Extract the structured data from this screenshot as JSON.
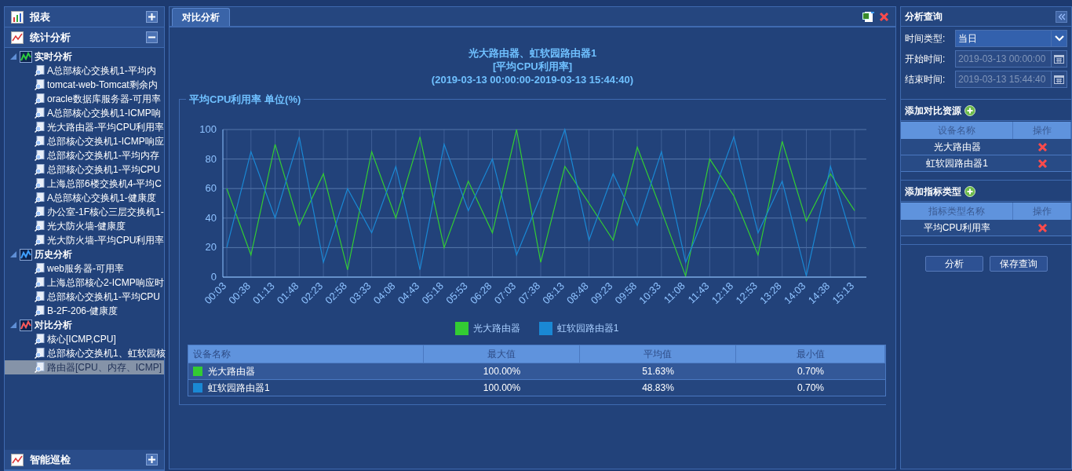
{
  "sidebar": {
    "sections": [
      {
        "title": "报表",
        "expanded": false
      },
      {
        "title": "统计分析",
        "expanded": true,
        "tree": [
          {
            "label": "实时分析",
            "expanded": true,
            "children": [
              {
                "label": "A总部核心交换机1-平均内",
                "selected": false
              },
              {
                "label": "tomcat-web-Tomcat剩余内",
                "selected": false
              },
              {
                "label": "oracle数据库服务器-可用率",
                "selected": false
              },
              {
                "label": "A总部核心交换机1-ICMP响",
                "selected": false
              },
              {
                "label": "光大路由器-平均CPU利用率",
                "selected": false
              },
              {
                "label": "总部核心交换机1-ICMP响应",
                "selected": false
              },
              {
                "label": "总部核心交换机1-平均内存",
                "selected": false
              },
              {
                "label": "总部核心交换机1-平均CPU",
                "selected": false
              },
              {
                "label": "上海总部6楼交换机4-平均C",
                "selected": false
              },
              {
                "label": "A总部核心交换机1-健康度",
                "selected": false
              },
              {
                "label": "办公室-1F核心三层交换机1-",
                "selected": false
              },
              {
                "label": "光大防火墙-健康度",
                "selected": false
              },
              {
                "label": "光大防火墙-平均CPU利用率",
                "selected": false
              }
            ]
          },
          {
            "label": "历史分析",
            "expanded": true,
            "children": [
              {
                "label": "web服务器-可用率",
                "selected": false
              },
              {
                "label": "上海总部核心2-ICMP响应时",
                "selected": false
              },
              {
                "label": "总部核心交换机1-平均CPU",
                "selected": false
              },
              {
                "label": "B-2F-206-健康度",
                "selected": false
              }
            ]
          },
          {
            "label": "对比分析",
            "expanded": true,
            "children": [
              {
                "label": "核心[ICMP,CPU]",
                "selected": false
              },
              {
                "label": "总部核心交换机1、虹软园核",
                "selected": false
              },
              {
                "label": "路由器[CPU、内存、ICMP]",
                "selected": true
              }
            ]
          }
        ]
      },
      {
        "title": "智能巡检",
        "expanded": false
      }
    ]
  },
  "main": {
    "tabs": [
      {
        "label": "对比分析",
        "selected": true
      }
    ],
    "report_title": [
      "光大路由器、虹软园路由器1",
      "[平均CPU利用率]",
      "(2019-03-13 00:00:00-2019-03-13 15:44:40)"
    ],
    "chart_data": {
      "type": "line",
      "grid": true,
      "legend": "bottom",
      "title": "平均CPU利用率 单位(%)",
      "ylim": [
        0,
        100
      ],
      "yticks": [
        0,
        20,
        40,
        60,
        80,
        100
      ],
      "categories": [
        "00:03",
        "00:38",
        "01:13",
        "01:48",
        "02:23",
        "02:58",
        "03:33",
        "04:08",
        "04:43",
        "05:18",
        "05:53",
        "06:28",
        "07:03",
        "07:38",
        "08:13",
        "08:48",
        "09:23",
        "09:58",
        "10:33",
        "11:08",
        "11:43",
        "12:18",
        "12:53",
        "13:28",
        "14:03",
        "14:38",
        "15:13"
      ],
      "series": [
        {
          "name": "光大路由器",
          "color": "#33cc33",
          "values": [
            60,
            15,
            90,
            35,
            70,
            5,
            85,
            40,
            95,
            20,
            65,
            30,
            100,
            10,
            75,
            50,
            25,
            88,
            45,
            0.7,
            80,
            55,
            15,
            92,
            38,
            70,
            45
          ]
        },
        {
          "name": "虹软园路由器1",
          "color": "#1a88d4",
          "values": [
            20,
            85,
            40,
            95,
            10,
            60,
            30,
            75,
            5,
            90,
            45,
            80,
            15,
            55,
            100,
            25,
            70,
            35,
            85,
            10,
            50,
            95,
            30,
            65,
            0.7,
            75,
            20
          ]
        }
      ]
    },
    "stats_table": {
      "columns": [
        "设备名称",
        "最大值",
        "平均值",
        "最小值"
      ],
      "rows": [
        {
          "name": "光大路由器",
          "color": "#33cc33",
          "max": "100.00%",
          "avg": "51.63%",
          "min": "0.70%"
        },
        {
          "name": "虹软园路由器1",
          "color": "#1a88d4",
          "max": "100.00%",
          "avg": "48.83%",
          "min": "0.70%"
        }
      ]
    }
  },
  "query": {
    "title": "分析查询",
    "fields": [
      {
        "label": "时间类型:",
        "value": "当日",
        "kind": "select",
        "disabled": false
      },
      {
        "label": "开始时间:",
        "value": "2019-03-13 00:00:00",
        "kind": "date",
        "disabled": true
      },
      {
        "label": "结束时间:",
        "value": "2019-03-13 15:44:40",
        "kind": "date",
        "disabled": true
      }
    ],
    "tables": [
      {
        "title": "添加对比资源",
        "columns": [
          "设备名称",
          "操作"
        ],
        "rows": [
          "光大路由器",
          "虹软园路由器1"
        ]
      },
      {
        "title": "添加指标类型",
        "columns": [
          "指标类型名称",
          "操作"
        ],
        "rows": [
          "平均CPU利用率"
        ]
      }
    ],
    "buttons": [
      "分析",
      "保存查询"
    ]
  }
}
